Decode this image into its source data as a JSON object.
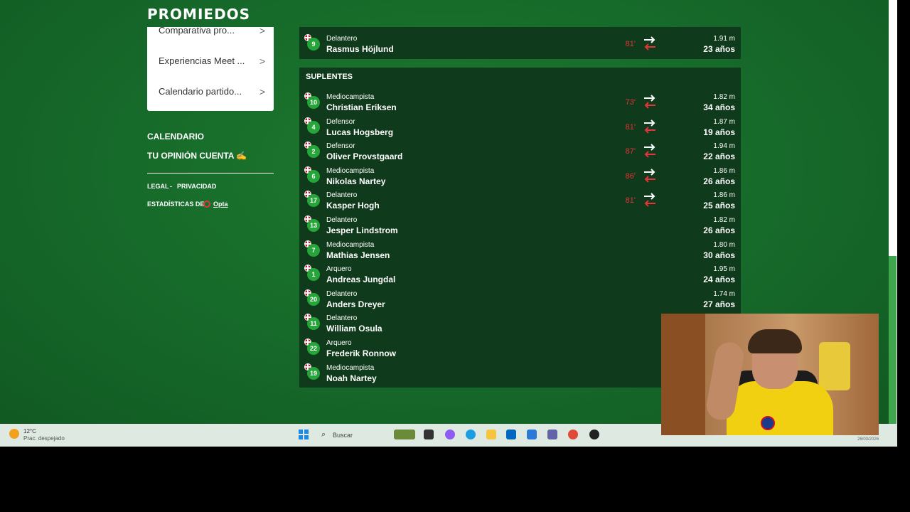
{
  "site": {
    "logo": "PROMIEDOS"
  },
  "sidebar": {
    "menu_items": [
      {
        "label": "Comparativa pro..."
      },
      {
        "label": "Experiencias Meet ..."
      },
      {
        "label": "Calendario partido..."
      }
    ],
    "chevron": ">",
    "links": [
      {
        "label": "CALENDARIO"
      },
      {
        "label": "TU OPINIÓN CUENTA ✍"
      }
    ],
    "legal": "LEGAL",
    "separator": "-",
    "privacy": "PRIVACIDAD",
    "stats_prefix": "ESTADÍSTICAS DE",
    "stats_brand": "Opta"
  },
  "starter_row": {
    "number": "9",
    "position": "Delantero",
    "name": "Rasmus Höjlund",
    "minute": "81'",
    "height": "1.91 m",
    "age": "23 años"
  },
  "subs": {
    "title": "SUPLENTES",
    "players": [
      {
        "number": "10",
        "position": "Mediocampista",
        "name": "Christian Eriksen",
        "minute": "73'",
        "height": "1.82 m",
        "age": "34 años"
      },
      {
        "number": "4",
        "position": "Defensor",
        "name": "Lucas Hogsberg",
        "minute": "81'",
        "height": "1.87 m",
        "age": "19 años"
      },
      {
        "number": "2",
        "position": "Defensor",
        "name": "Oliver Provstgaard",
        "minute": "87'",
        "height": "1.94 m",
        "age": "22 años"
      },
      {
        "number": "6",
        "position": "Mediocampista",
        "name": "Nikolas Nartey",
        "minute": "86'",
        "height": "1.86 m",
        "age": "26 años"
      },
      {
        "number": "17",
        "position": "Delantero",
        "name": "Kasper Hogh",
        "minute": "81'",
        "height": "1.86 m",
        "age": "25 años"
      },
      {
        "number": "13",
        "position": "Delantero",
        "name": "Jesper Lindstrom",
        "minute": "",
        "height": "1.82 m",
        "age": "26 años"
      },
      {
        "number": "7",
        "position": "Mediocampista",
        "name": "Mathias Jensen",
        "minute": "",
        "height": "1.80 m",
        "age": "30 años"
      },
      {
        "number": "1",
        "position": "Arquero",
        "name": "Andreas Jungdal",
        "minute": "",
        "height": "1.95 m",
        "age": "24 años"
      },
      {
        "number": "20",
        "position": "Delantero",
        "name": "Anders Dreyer",
        "minute": "",
        "height": "1.74 m",
        "age": "27 años"
      },
      {
        "number": "11",
        "position": "Delantero",
        "name": "William Osula",
        "minute": "",
        "height": "",
        "age": ""
      },
      {
        "number": "22",
        "position": "Arquero",
        "name": "Frederik Ronnow",
        "minute": "",
        "height": "",
        "age": ""
      },
      {
        "number": "19",
        "position": "Mediocampista",
        "name": "Noah Nartey",
        "minute": "",
        "height": "",
        "age": ""
      }
    ]
  },
  "taskbar": {
    "temperature": "12°C",
    "weather": "Prac. despejado",
    "search_label": "Buscar",
    "date": "26/03/2026"
  },
  "colors": {
    "accent_green": "#26a53a",
    "sub_red": "#e5343a",
    "panel": "#0f3a1b"
  }
}
